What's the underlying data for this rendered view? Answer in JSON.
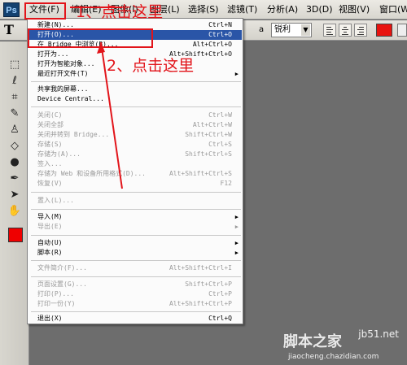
{
  "menubar": {
    "app_icon": "Ps",
    "items": [
      "文件(F)",
      "编辑(E)",
      "图像(I)",
      "图层(L)",
      "选择(S)",
      "滤镜(T)",
      "分析(A)",
      "3D(D)",
      "视图(V)",
      "窗口(W)"
    ]
  },
  "options": {
    "tool_letter": "T",
    "aa_label": "a",
    "aa_value": "锐利",
    "color": "#e8130f"
  },
  "file_menu": {
    "items": [
      {
        "label": "新建(N)...",
        "shortcut": "Ctrl+N",
        "enabled": true
      },
      {
        "label": "打开(O)...",
        "shortcut": "Ctrl+O",
        "enabled": true,
        "highlight": true
      },
      {
        "label": "在 Bridge 中浏览(B)...",
        "shortcut": "Alt+Ctrl+O",
        "enabled": true
      },
      {
        "label": "打开为...",
        "shortcut": "Alt+Shift+Ctrl+O",
        "enabled": true
      },
      {
        "label": "打开为智能对象...",
        "shortcut": "",
        "enabled": true
      },
      {
        "label": "最近打开文件(T)",
        "shortcut": "",
        "enabled": true,
        "submenu": true
      },
      {
        "label": "共享我的屏幕...",
        "shortcut": "",
        "enabled": true
      },
      {
        "label": "Device Central...",
        "shortcut": "",
        "enabled": true
      },
      {
        "label": "关闭(C)",
        "shortcut": "Ctrl+W",
        "enabled": false
      },
      {
        "label": "关闭全部",
        "shortcut": "Alt+Ctrl+W",
        "enabled": false
      },
      {
        "label": "关闭并转到 Bridge...",
        "shortcut": "Shift+Ctrl+W",
        "enabled": false
      },
      {
        "label": "存储(S)",
        "shortcut": "Ctrl+S",
        "enabled": false
      },
      {
        "label": "存储为(A)...",
        "shortcut": "Shift+Ctrl+S",
        "enabled": false
      },
      {
        "label": "签入...",
        "shortcut": "",
        "enabled": false
      },
      {
        "label": "存储为 Web 和设备所用格式(D)...",
        "shortcut": "Alt+Shift+Ctrl+S",
        "enabled": false
      },
      {
        "label": "恢复(V)",
        "shortcut": "F12",
        "enabled": false
      },
      {
        "label": "置入(L)...",
        "shortcut": "",
        "enabled": false
      },
      {
        "label": "导入(M)",
        "shortcut": "",
        "enabled": true,
        "submenu": true
      },
      {
        "label": "导出(E)",
        "shortcut": "",
        "enabled": false,
        "submenu": true
      },
      {
        "label": "自动(U)",
        "shortcut": "",
        "enabled": true,
        "submenu": true
      },
      {
        "label": "脚本(R)",
        "shortcut": "",
        "enabled": true,
        "submenu": true
      },
      {
        "label": "文件简介(F)...",
        "shortcut": "Alt+Shift+Ctrl+I",
        "enabled": false
      },
      {
        "label": "页面设置(G)...",
        "shortcut": "Shift+Ctrl+P",
        "enabled": false
      },
      {
        "label": "打印(P)...",
        "shortcut": "Ctrl+P",
        "enabled": false
      },
      {
        "label": "打印一份(Y)",
        "shortcut": "Alt+Shift+Ctrl+P",
        "enabled": false
      },
      {
        "label": "退出(X)",
        "shortcut": "Ctrl+Q",
        "enabled": true
      }
    ],
    "submenu_glyph": "▶"
  },
  "annotations": {
    "step1": "1、点击这里",
    "step2": "2、点击这里",
    "color": "#e2141a"
  },
  "watermark": {
    "big": "脚本之家",
    "site": "jb51.net",
    "sub": "jiaocheng.chazidian.com"
  }
}
